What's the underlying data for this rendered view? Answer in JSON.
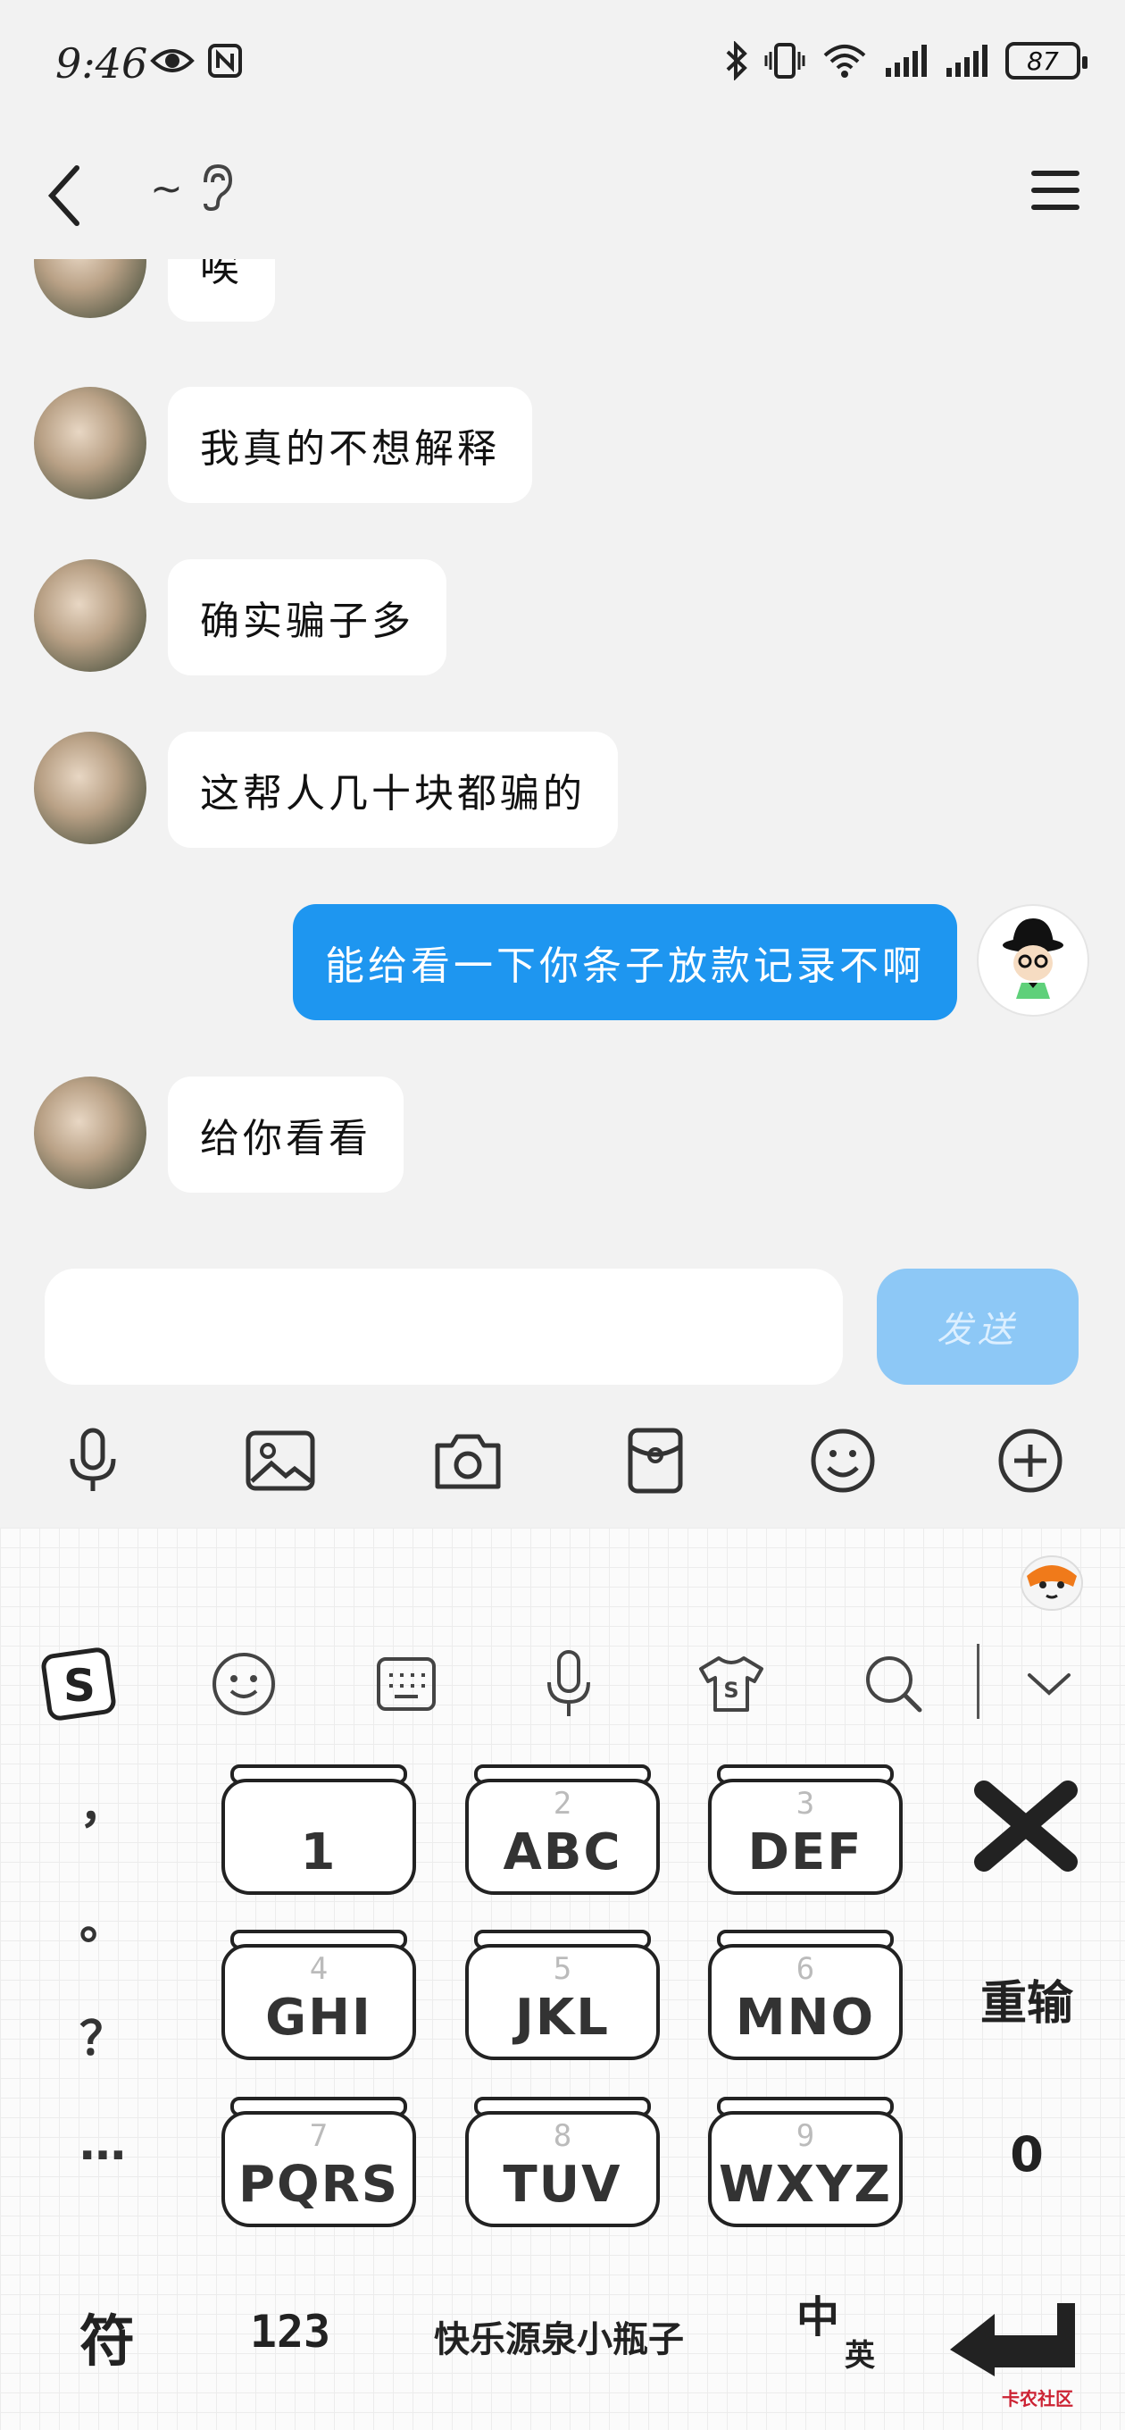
{
  "status_bar": {
    "time": "9:46",
    "battery": "87",
    "icons_left": [
      "eye-icon",
      "nfc-icon"
    ],
    "icons_right": [
      "bluetooth-icon",
      "vibrate-icon",
      "wifi-icon",
      "signal-icon",
      "signal-icon",
      "battery-icon"
    ]
  },
  "nav": {
    "title": "~",
    "back_icon": "back-chevron-icon",
    "ear_icon": "ear-icon",
    "menu_icon": "hamburger-menu-icon"
  },
  "messages": [
    {
      "side": "left",
      "text": "唉"
    },
    {
      "side": "left",
      "text": "我真的不想解释"
    },
    {
      "side": "left",
      "text": "确实骗子多"
    },
    {
      "side": "left",
      "text": "这帮人几十块都骗的"
    },
    {
      "side": "right",
      "text": "能给看一下你条子放款记录不啊"
    },
    {
      "side": "left",
      "text": "给你看看"
    }
  ],
  "composer": {
    "input_value": "",
    "send_label": "发送",
    "tools": [
      "microphone-icon",
      "image-icon",
      "camera-icon",
      "red-packet-icon",
      "emoji-icon",
      "plus-icon"
    ]
  },
  "keyboard": {
    "toolbar": [
      "sogou-logo-icon",
      "emoji-icon",
      "keyboard-icon",
      "microphone-icon",
      "skin-shirt-icon",
      "search-icon",
      "collapse-chevron-icon"
    ],
    "punctuation": [
      "，",
      "。",
      "？",
      "…"
    ],
    "keys": [
      {
        "num": "",
        "letters": "1"
      },
      {
        "num": "2",
        "letters": "ABC"
      },
      {
        "num": "3",
        "letters": "DEF"
      },
      {
        "num": "4",
        "letters": "GHI"
      },
      {
        "num": "5",
        "letters": "JKL"
      },
      {
        "num": "6",
        "letters": "MNO"
      },
      {
        "num": "7",
        "letters": "PQRS"
      },
      {
        "num": "8",
        "letters": "TUV"
      },
      {
        "num": "9",
        "letters": "WXYZ"
      }
    ],
    "delete_icon": "delete-x-icon",
    "reenter_label": "重输",
    "zero_label": "0",
    "symbols_label": "符",
    "numbers_label": "123",
    "space_label": "快乐源泉小瓶子",
    "lang_cn": "中",
    "lang_en": "英",
    "enter_icon": "enter-icon",
    "watermark": "卡农社区"
  }
}
